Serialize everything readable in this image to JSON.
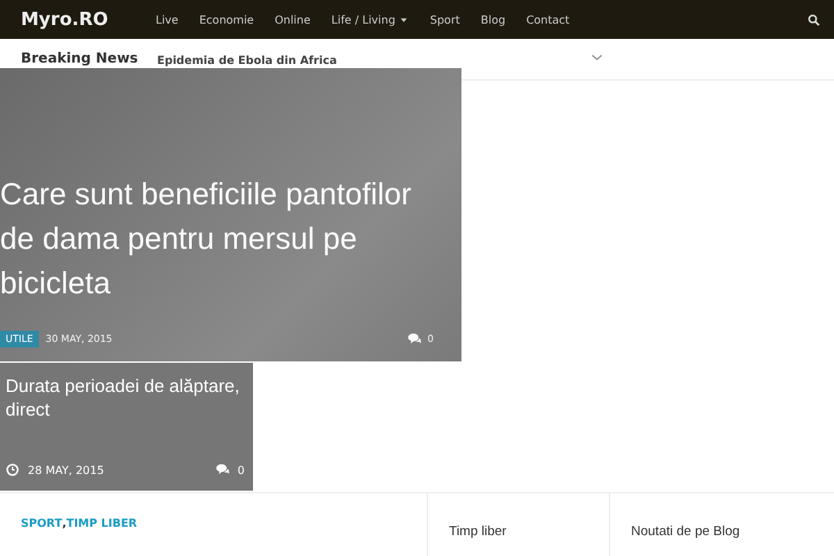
{
  "navbar": {
    "logo": "Myro.RO",
    "items": [
      {
        "label": "Live",
        "dropdown": false
      },
      {
        "label": "Economie",
        "dropdown": false
      },
      {
        "label": "Online",
        "dropdown": false
      },
      {
        "label": "Life / Living",
        "dropdown": true
      },
      {
        "label": "Sport",
        "dropdown": false
      },
      {
        "label": "Blog",
        "dropdown": false
      },
      {
        "label": "Contact",
        "dropdown": false
      }
    ]
  },
  "breaking_news": {
    "label": "Breaking News",
    "headline": "Epidemia de Ebola din Africa"
  },
  "featured": {
    "title": "Care sunt beneficiile pantofilor de dama pentru mersul pe bicicleta",
    "tag": "UTILE",
    "date": "30 MAY, 2015",
    "comments": "0"
  },
  "second_post": {
    "title": "Durata perioadei de alăptare, direct",
    "date": "28 MAY, 2015",
    "comments": "0"
  },
  "bottom": {
    "categories": [
      "SPORT",
      "TIMP LIBER"
    ],
    "separator": ",",
    "widgets": [
      "Timp liber",
      "Noutati de pe Blog"
    ]
  }
}
